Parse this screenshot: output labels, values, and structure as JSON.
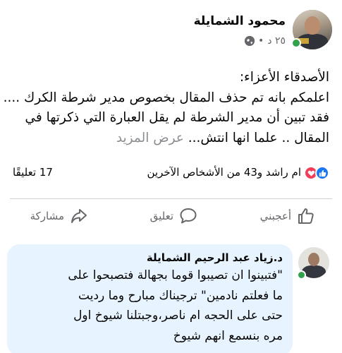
{
  "post": {
    "author": "محمود الشمايلة",
    "time": "٢٥ د",
    "separator": "•",
    "text_lines": [
      "الأصدقاء الأعزاء:",
      "اعلمكم بانه تم حذف المقال بخصوص مدير شرطة الكرك ....",
      "فقد تبين أن مدير الشرطة لم يقل العبارة التي ذكرتها في",
      "المقال .. علما انها انتش..."
    ],
    "see_more": "عرض المزيد",
    "privacy_icon": "globe-icon"
  },
  "reactions": {
    "summary": "ام راشد و43 من الأشخاص الآخرين",
    "comments": "17 تعليقًا",
    "icons": [
      "like-icon",
      "love-icon"
    ],
    "like_color": "#1877f2",
    "love_color": "#f33e58"
  },
  "actions": {
    "like": "أعجبني",
    "comment": "تعليق",
    "share": "مشاركة"
  },
  "comment": {
    "author": "د.زياد عبد الرحيم الشمايلة",
    "lines": [
      "\"فتبينوا ان تصيبوا قوما بجهالة فتصبحوا على",
      "ما فعلتم نادمين\" ترجيناك مبارح وما رديت",
      "حتى على الحجه ام ناصر،وجبتلنا شيوخ اول",
      "مره بنسمع انهم شيوخ"
    ],
    "bubble_color": "#e7f3ff"
  },
  "colors": {
    "online": "#31a24c",
    "secondary_text": "#65676b",
    "see_more": "#8a8d91"
  }
}
